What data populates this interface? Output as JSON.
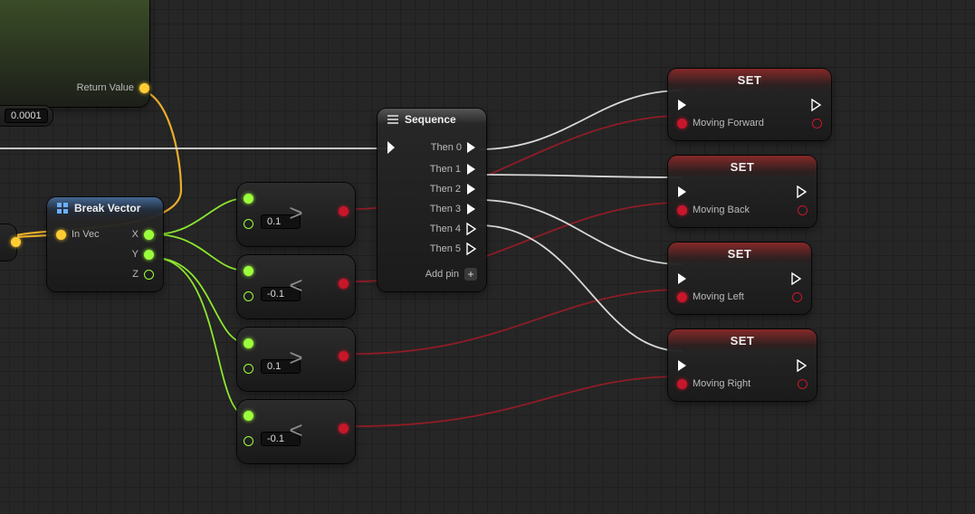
{
  "topFragment": {
    "returnLabel": "Return Value",
    "tolerance": "0.0001"
  },
  "breakVector": {
    "title": "Break Vector",
    "inLabel": "In Vec",
    "axes": {
      "x": "X",
      "y": "Y",
      "z": "Z"
    }
  },
  "compare": [
    {
      "op": ">",
      "value": "0.1"
    },
    {
      "op": "<",
      "value": "-0.1"
    },
    {
      "op": ">",
      "value": "0.1"
    },
    {
      "op": "<",
      "value": "-0.1"
    }
  ],
  "sequence": {
    "title": "Sequence",
    "pins": [
      "Then 0",
      "Then 1",
      "Then 2",
      "Then 3",
      "Then 4",
      "Then 5"
    ],
    "addPin": "Add pin"
  },
  "sets": [
    {
      "title": "SET",
      "var": "Moving Forward"
    },
    {
      "title": "SET",
      "var": "Moving Back"
    },
    {
      "title": "SET",
      "var": "Moving Left"
    },
    {
      "title": "SET",
      "var": "Moving Right"
    }
  ]
}
